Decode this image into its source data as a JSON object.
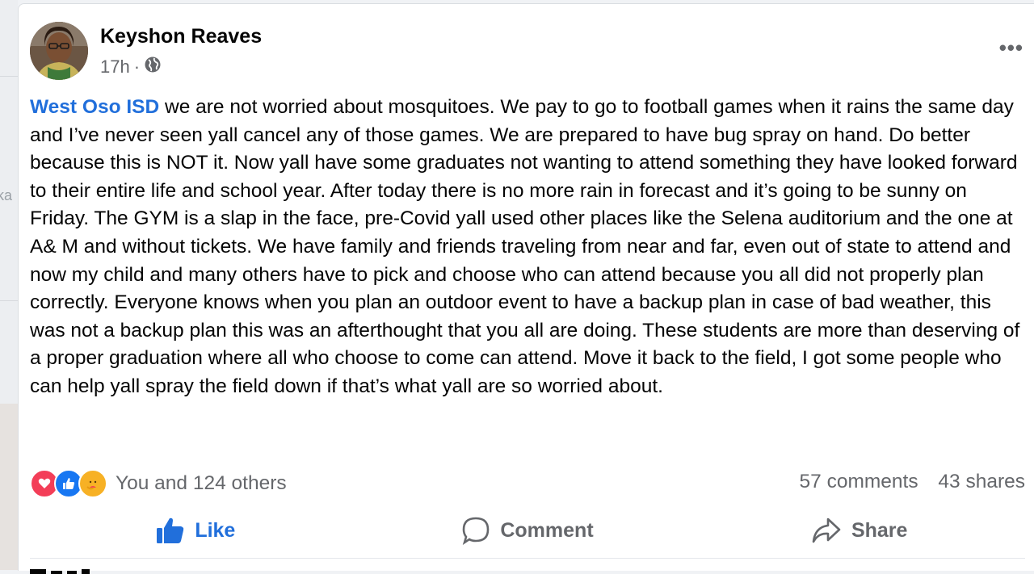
{
  "post": {
    "author": "Keyshon Reaves",
    "time": "17h",
    "separator": "·",
    "audience_icon": "globe-icon",
    "more_icon": "more-horizontal-icon",
    "more_glyph": "•••",
    "mention": "West Oso ISD",
    "body": " we are not worried about mosquitoes. We pay to go to football games when it rains the same day and I’ve never seen yall cancel any of those games. We are prepared to have bug spray on hand. Do better because this is NOT it. Now yall have some graduates not wanting to attend something they have looked forward to their entire life and school year. After today there is no more rain in forecast and it’s going to be sunny on Friday. The GYM is a slap in the face, pre-Covid yall used other places like the Selena auditorium and the one at A& M and without tickets. We have family and friends traveling from near and far, even out of state to attend and now my child and many others have to pick and choose who can attend because you all did not properly plan correctly. Everyone knows when you plan an outdoor event to have a backup plan in case of bad weather, this was not a backup plan this was an afterthought that you all are doing. These students are more than deserving of a proper graduation where all who choose to come can attend. Move it back to the field, I got some people who can help yall spray the field down if that’s what yall are so worried about."
  },
  "reactions": {
    "icons": [
      "love-reaction-icon",
      "like-reaction-icon",
      "care-reaction-icon"
    ],
    "summary": "You and 124 others",
    "comments": "57 comments",
    "shares": "43 shares"
  },
  "actions": {
    "like": "Like",
    "comment": "Comment",
    "share": "Share"
  },
  "colors": {
    "mention": "#216fdb",
    "like_active": "#216fdb",
    "love": "#f33e58",
    "like_reaction": "#1877f2",
    "care": "#f7b125",
    "secondary_text": "#65676b"
  },
  "sidebar_fragment": "ka"
}
